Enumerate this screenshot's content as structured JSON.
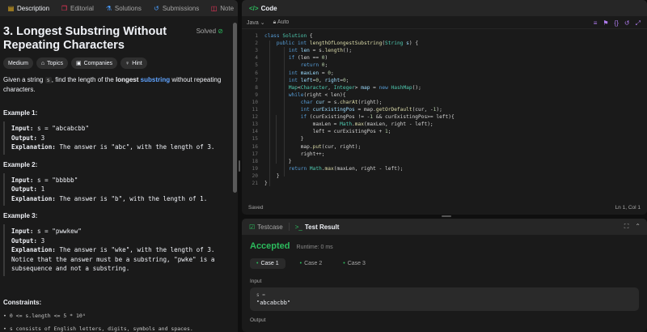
{
  "tabs": {
    "description": "Description",
    "editorial": "Editorial",
    "solutions": "Solutions",
    "submissions": "Submissions",
    "note": "Note",
    "close": "✕"
  },
  "problem": {
    "title": "3. Longest Substring Without Repeating Characters",
    "solved": "Solved",
    "chips": [
      "Medium",
      "Topics",
      "Companies",
      "Hint"
    ],
    "desc_pre": "Given a string ",
    "desc_code": "s",
    "desc_mid": ", find the length of the ",
    "desc_kw1": "longest",
    "desc_kw2": "substring",
    "desc_post": " without repeating characters.",
    "examples": [
      {
        "heading": "Example 1:",
        "input_label": "Input:",
        "input": " s = \"abcabcbb\"",
        "output_label": "Output:",
        "output": " 3",
        "expl_label": "Explanation:",
        "expl": " The answer is \"abc\", with the length of 3."
      },
      {
        "heading": "Example 2:",
        "input_label": "Input:",
        "input": " s = \"bbbbb\"",
        "output_label": "Output:",
        "output": " 1",
        "expl_label": "Explanation:",
        "expl": " The answer is \"b\", with the length of 1."
      },
      {
        "heading": "Example 3:",
        "input_label": "Input:",
        "input": " s = \"pwwkew\"",
        "output_label": "Output:",
        "output": " 3",
        "expl_label": "Explanation:",
        "expl": " The answer is \"wke\", with the length of 3.\nNotice that the answer must be a substring, \"pwke\" is a\nsubsequence and not a substring."
      }
    ],
    "constraints_heading": "Constraints:",
    "constraints": [
      "0 <= s.length <= 5 * 10⁴",
      "s consists of English letters, digits, symbols and spaces."
    ]
  },
  "code": {
    "panel_title": "Code",
    "language": "Java",
    "autosave": "Auto",
    "status_left": "Saved",
    "status_right": "Ln 1, Col 1",
    "lines": [
      "1",
      "2",
      "3",
      "4",
      "5",
      "6",
      "7",
      "8",
      "9",
      "10",
      "11",
      "12",
      "13",
      "14",
      "15",
      "16",
      "17",
      "18",
      "19",
      "20",
      "21"
    ]
  },
  "result": {
    "tab_testcase": "Testcase",
    "tab_result": "Test Result",
    "verdict": "Accepted",
    "runtime": "Runtime: 0 ms",
    "cases": [
      "Case 1",
      "Case 2",
      "Case 3"
    ],
    "input_label": "Input",
    "var_label": "s =",
    "input_value": "\"abcabcbb\"",
    "output_label": "Output"
  },
  "colors": {
    "accent_yellow": "#ffc01e",
    "accepted_green": "#2cbb5d",
    "panel_bg": "#1a1a1a",
    "app_bg": "#0f0f0f"
  }
}
